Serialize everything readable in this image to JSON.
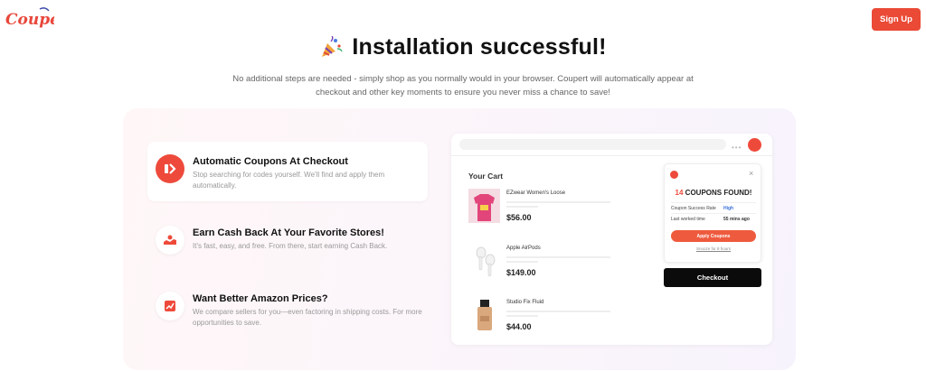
{
  "header": {
    "logo_text": "Coupert",
    "signup_label": "Sign Up"
  },
  "hero": {
    "title": "Installation successful!",
    "subtitle": "No additional steps are needed - simply shop as you normally would in your browser. Coupert will automatically appear at checkout and other key moments to ensure you never miss a chance to save!"
  },
  "features": [
    {
      "title": "Automatic Coupons At Checkout",
      "description": "Stop searching for codes yourself. We'll find and apply them automatically.",
      "icon": "coupon-icon"
    },
    {
      "title": "Earn Cash Back At Your Favorite Stores!",
      "description": "It's fast, easy, and free. From there, start earning Cash Back.",
      "icon": "cashback-icon"
    },
    {
      "title": "Want Better Amazon Prices?",
      "description": "We compare sellers for you—even factoring in shipping costs. For more opportunities to save.",
      "icon": "trend-icon"
    }
  ],
  "mock": {
    "cart_title": "Your Cart",
    "items": [
      {
        "name": "EZwear Women's Loose",
        "price": "$56.00"
      },
      {
        "name": "Apple AirPods",
        "price": "$149.00"
      },
      {
        "name": "Studio Fix Fluid",
        "price": "$44.00"
      }
    ],
    "popup": {
      "count": "14",
      "found_text": "COUPONS FOUND!",
      "rate_label": "Coupon Success Rate",
      "rate_value": "High",
      "worked_label": "Last worked time",
      "worked_value": "55 mins ago",
      "apply_label": "Apply Coupons",
      "link_label": "Snooze for 8 hours",
      "close_glyph": "×"
    },
    "checkout_label": "Checkout",
    "dots": "•••"
  },
  "colors": {
    "brand": "#ea4a36",
    "panel_bg": "#fbf5fb"
  }
}
